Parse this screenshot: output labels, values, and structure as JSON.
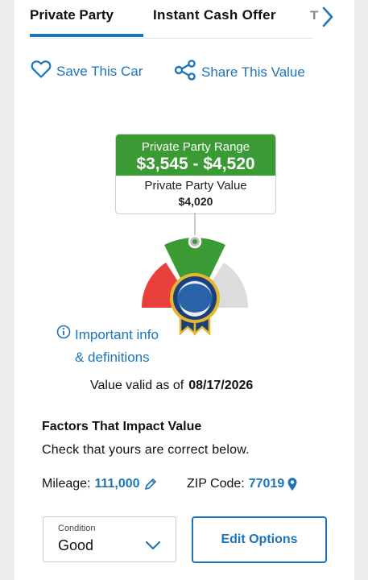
{
  "tabs": [
    {
      "label": "Private Party",
      "active": true
    },
    {
      "label": "Instant Cash Offer",
      "active": false
    }
  ],
  "next_tab_fragment": "T",
  "icons": {
    "next": "chevron-right-icon",
    "save": "heart-outline-icon",
    "share": "share-nodes-icon",
    "info": "info-circle-icon",
    "mileage_edit": "pencil-icon",
    "zip_location": "map-pin-icon",
    "condition": "chevron-down-icon",
    "badge": "kbb-ribbon-badge-icon"
  },
  "actions": {
    "save_label": "Save This Car",
    "share_label": "Share This Value"
  },
  "value_box": {
    "range_label": "Private Party Range",
    "range_value": "$3,545 - $4,520",
    "value_label": "Private Party Value",
    "value": "$4,020"
  },
  "info": {
    "line1": "Important info",
    "line2": "& definitions"
  },
  "valid": {
    "prefix": "Value valid as of",
    "date": "08/17/2026"
  },
  "factors": {
    "title": "Factors That Impact Value",
    "subtitle": "Check that yours are correct below.",
    "mileage_label": "Mileage:",
    "mileage_value": "111,000",
    "zip_label": "ZIP Code:",
    "zip_value": "77019"
  },
  "condition": {
    "label": "Condition",
    "value": "Good"
  },
  "edit_options_label": "Edit Options",
  "colors": {
    "accent": "#1b75bb",
    "green": "#3a9a34",
    "red": "#e8403a",
    "gray": "#dcdcdc",
    "navy": "#1b3f7a",
    "gold": "#e6b72a"
  }
}
